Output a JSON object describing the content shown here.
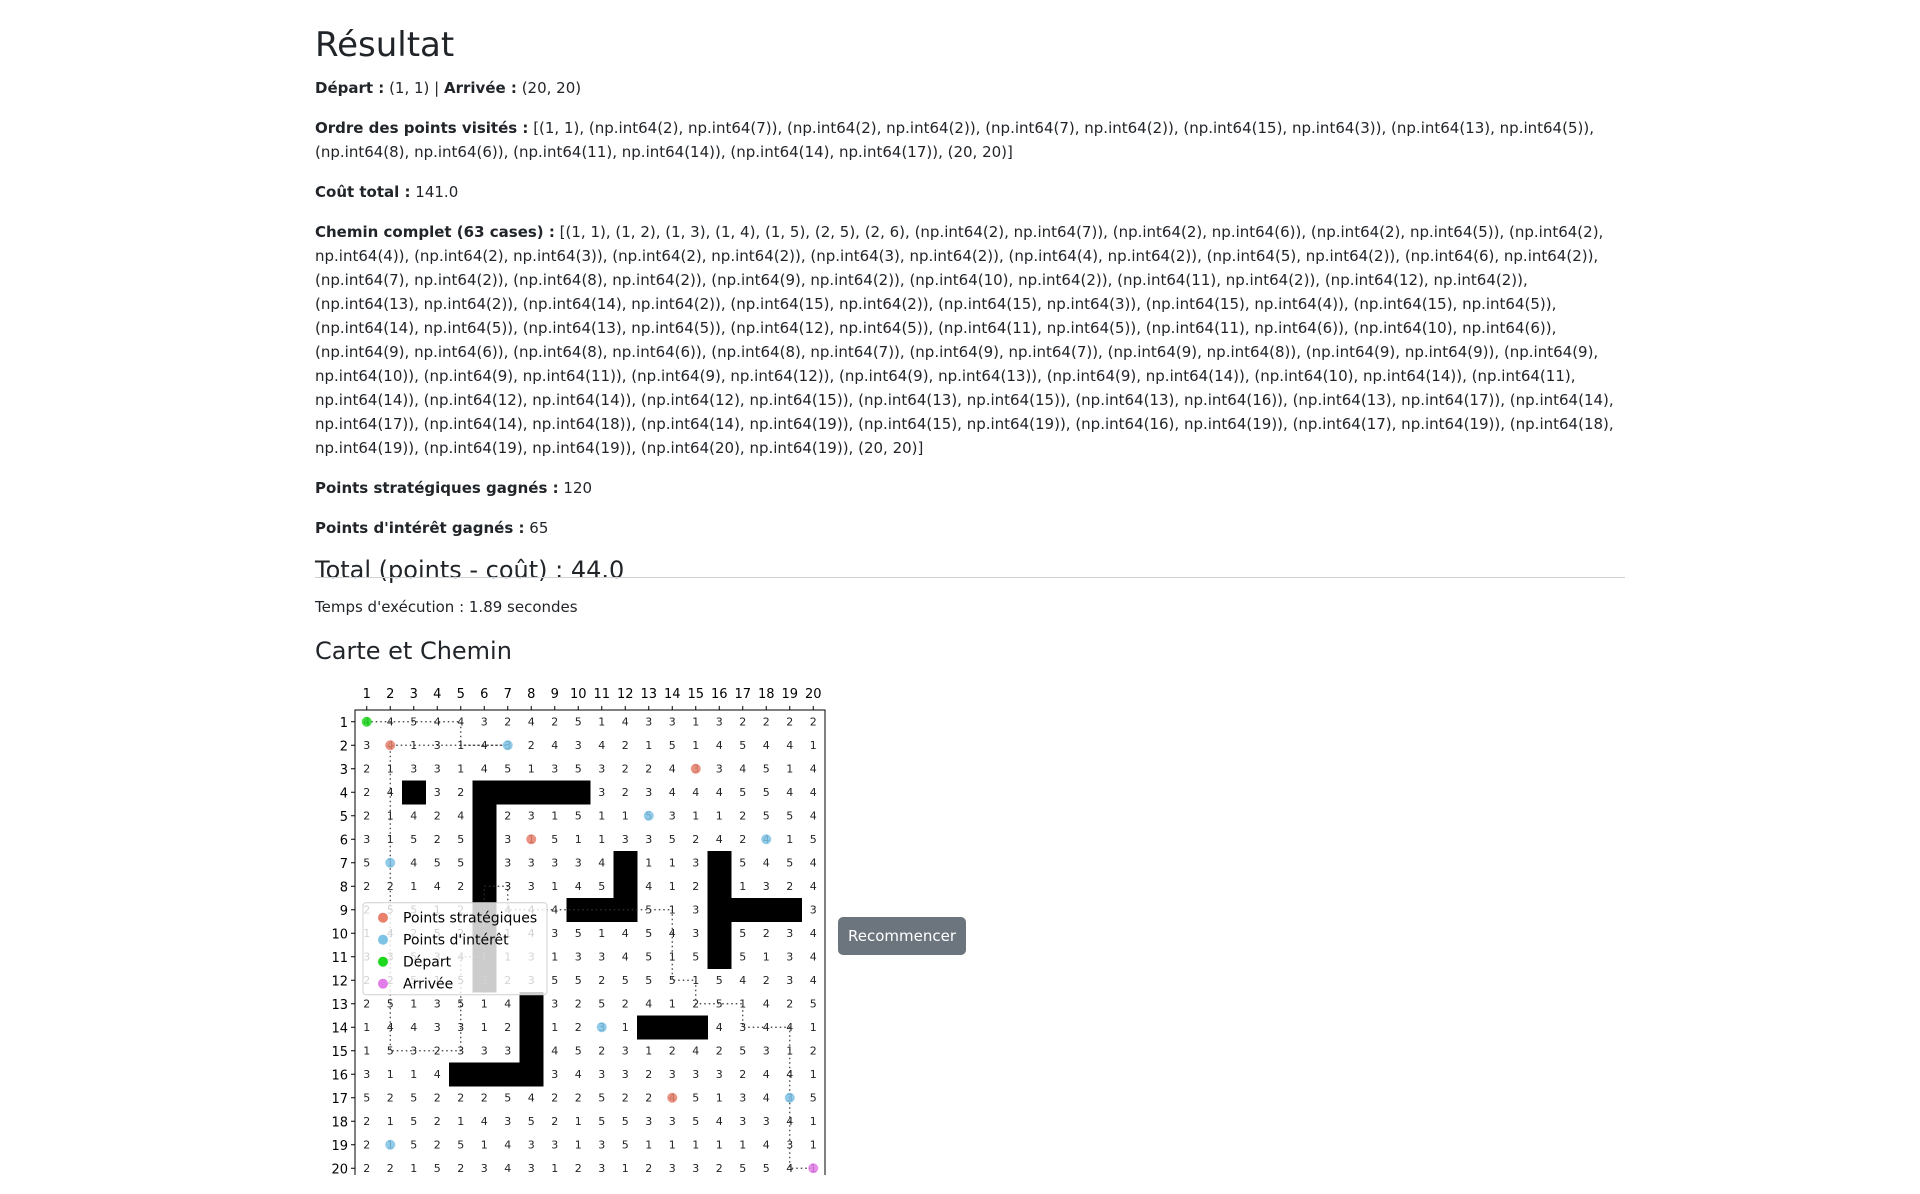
{
  "heading": "Résultat",
  "depart_label": "Départ :",
  "depart_value": "(1, 1)",
  "separator": "|",
  "arrivee_label": "Arrivée :",
  "arrivee_value": "(20, 20)",
  "ordre_label": "Ordre des points visités :",
  "ordre_value": "[(1, 1), (np.int64(2), np.int64(7)), (np.int64(2), np.int64(2)), (np.int64(7), np.int64(2)), (np.int64(15), np.int64(3)), (np.int64(13), np.int64(5)), (np.int64(8), np.int64(6)), (np.int64(11), np.int64(14)), (np.int64(14), np.int64(17)), (20, 20)]",
  "cout_label": "Coût total :",
  "cout_value": "141.0",
  "chemin_label": "Chemin complet (63 cases) :",
  "chemin_value": "[(1, 1), (1, 2), (1, 3), (1, 4), (1, 5), (2, 5), (2, 6), (np.int64(2), np.int64(7)), (np.int64(2), np.int64(6)), (np.int64(2), np.int64(5)), (np.int64(2), np.int64(4)), (np.int64(2), np.int64(3)), (np.int64(2), np.int64(2)), (np.int64(3), np.int64(2)), (np.int64(4), np.int64(2)), (np.int64(5), np.int64(2)), (np.int64(6), np.int64(2)), (np.int64(7), np.int64(2)), (np.int64(8), np.int64(2)), (np.int64(9), np.int64(2)), (np.int64(10), np.int64(2)), (np.int64(11), np.int64(2)), (np.int64(12), np.int64(2)), (np.int64(13), np.int64(2)), (np.int64(14), np.int64(2)), (np.int64(15), np.int64(2)), (np.int64(15), np.int64(3)), (np.int64(15), np.int64(4)), (np.int64(15), np.int64(5)), (np.int64(14), np.int64(5)), (np.int64(13), np.int64(5)), (np.int64(12), np.int64(5)), (np.int64(11), np.int64(5)), (np.int64(11), np.int64(6)), (np.int64(10), np.int64(6)), (np.int64(9), np.int64(6)), (np.int64(8), np.int64(6)), (np.int64(8), np.int64(7)), (np.int64(9), np.int64(7)), (np.int64(9), np.int64(8)), (np.int64(9), np.int64(9)), (np.int64(9), np.int64(10)), (np.int64(9), np.int64(11)), (np.int64(9), np.int64(12)), (np.int64(9), np.int64(13)), (np.int64(9), np.int64(14)), (np.int64(10), np.int64(14)), (np.int64(11), np.int64(14)), (np.int64(12), np.int64(14)), (np.int64(12), np.int64(15)), (np.int64(13), np.int64(15)), (np.int64(13), np.int64(16)), (np.int64(13), np.int64(17)), (np.int64(14), np.int64(17)), (np.int64(14), np.int64(18)), (np.int64(14), np.int64(19)), (np.int64(15), np.int64(19)), (np.int64(16), np.int64(19)), (np.int64(17), np.int64(19)), (np.int64(18), np.int64(19)), (np.int64(19), np.int64(19)), (np.int64(20), np.int64(19)), (20, 20)]",
  "strat_label": "Points stratégiques gagnés :",
  "strat_value": "120",
  "interet_label": "Points d'intérêt gagnés :",
  "interet_value": "65",
  "total_label": "Total (points - coût) : 44.0",
  "exec_time": "Temps d'exécution : 1.89 secondes",
  "map_title": "Carte et Chemin",
  "button_label": "Recommencer",
  "chart_data": {
    "type": "heatmap",
    "x_ticks": [
      "1",
      "2",
      "3",
      "4",
      "5",
      "6",
      "7",
      "8",
      "9",
      "10",
      "11",
      "12",
      "13",
      "14",
      "15",
      "16",
      "17",
      "18",
      "19",
      "20"
    ],
    "y_ticks": [
      "1",
      "2",
      "3",
      "4",
      "5",
      "6",
      "7",
      "8",
      "9",
      "10",
      "11",
      "12",
      "13",
      "14",
      "15",
      "16",
      "17",
      "18",
      "19",
      "20"
    ],
    "grid": [
      [
        4,
        4,
        5,
        4,
        4,
        3,
        2,
        4,
        2,
        5,
        1,
        4,
        3,
        3,
        1,
        3,
        2,
        2,
        2,
        2
      ],
      [
        3,
        4,
        1,
        3,
        1,
        4,
        3,
        2,
        4,
        3,
        4,
        2,
        1,
        5,
        1,
        4,
        5,
        4,
        4,
        1
      ],
      [
        2,
        1,
        3,
        3,
        1,
        4,
        5,
        1,
        3,
        5,
        3,
        2,
        2,
        4,
        3,
        3,
        4,
        5,
        1,
        4
      ],
      [
        2,
        4,
        0,
        3,
        2,
        0,
        0,
        0,
        0,
        0,
        3,
        2,
        3,
        4,
        4,
        4,
        5,
        5,
        4,
        4
      ],
      [
        2,
        1,
        4,
        2,
        4,
        0,
        2,
        3,
        1,
        5,
        1,
        1,
        5,
        3,
        1,
        1,
        2,
        5,
        5,
        4
      ],
      [
        3,
        1,
        5,
        2,
        5,
        0,
        3,
        1,
        5,
        1,
        1,
        3,
        3,
        5,
        2,
        4,
        2,
        4,
        1,
        5
      ],
      [
        5,
        1,
        4,
        5,
        5,
        0,
        3,
        3,
        3,
        3,
        4,
        0,
        1,
        1,
        3,
        0,
        5,
        4,
        5,
        4
      ],
      [
        2,
        2,
        1,
        4,
        2,
        0,
        3,
        3,
        1,
        4,
        5,
        0,
        4,
        1,
        2,
        0,
        1,
        3,
        2,
        4
      ],
      [
        2,
        5,
        5,
        1,
        2,
        0,
        4,
        4,
        4,
        0,
        0,
        0,
        5,
        1,
        3,
        0,
        0,
        0,
        0,
        3
      ],
      [
        1,
        4,
        2,
        5,
        2,
        0,
        1,
        4,
        3,
        5,
        1,
        4,
        5,
        4,
        3,
        0,
        5,
        2,
        3,
        4
      ],
      [
        3,
        3,
        5,
        3,
        4,
        1,
        1,
        3,
        1,
        3,
        3,
        4,
        5,
        1,
        5,
        0,
        5,
        1,
        3,
        4
      ],
      [
        2,
        2,
        5,
        1,
        5,
        3,
        2,
        3,
        5,
        5,
        2,
        5,
        5,
        5,
        1,
        5,
        4,
        2,
        3,
        4
      ],
      [
        2,
        5,
        1,
        3,
        5,
        1,
        4,
        0,
        3,
        2,
        5,
        2,
        4,
        1,
        2,
        5,
        1,
        4,
        2,
        5
      ],
      [
        1,
        4,
        4,
        3,
        3,
        1,
        2,
        0,
        1,
        2,
        3,
        1,
        0,
        0,
        0,
        4,
        3,
        4,
        4,
        1
      ],
      [
        1,
        5,
        3,
        2,
        3,
        3,
        3,
        0,
        4,
        5,
        2,
        3,
        1,
        2,
        4,
        2,
        5,
        3,
        1,
        2
      ],
      [
        3,
        1,
        1,
        4,
        0,
        0,
        0,
        0,
        3,
        4,
        3,
        3,
        2,
        3,
        3,
        3,
        2,
        4,
        4,
        1
      ],
      [
        5,
        2,
        5,
        2,
        2,
        2,
        5,
        4,
        2,
        2,
        5,
        2,
        2,
        4,
        5,
        1,
        3,
        4,
        3,
        5
      ],
      [
        2,
        1,
        5,
        2,
        1,
        4,
        3,
        5,
        2,
        1,
        5,
        5,
        3,
        3,
        5,
        4,
        3,
        3,
        4,
        1
      ],
      [
        2,
        1,
        5,
        2,
        5,
        1,
        4,
        3,
        3,
        1,
        3,
        5,
        1,
        1,
        1,
        1,
        1,
        4,
        3,
        1
      ],
      [
        2,
        2,
        1,
        5,
        2,
        3,
        4,
        3,
        1,
        2,
        3,
        1,
        2,
        3,
        3,
        2,
        5,
        5,
        4,
        1
      ]
    ],
    "obstacles": [
      [
        4,
        3
      ],
      [
        4,
        6
      ],
      [
        4,
        7
      ],
      [
        4,
        8
      ],
      [
        4,
        9
      ],
      [
        4,
        10
      ],
      [
        5,
        6
      ],
      [
        6,
        6
      ],
      [
        7,
        6
      ],
      [
        8,
        6
      ],
      [
        9,
        6
      ],
      [
        10,
        6
      ],
      [
        11,
        6
      ],
      [
        12,
        6
      ],
      [
        7,
        12
      ],
      [
        8,
        12
      ],
      [
        9,
        10
      ],
      [
        9,
        11
      ],
      [
        9,
        12
      ],
      [
        7,
        16
      ],
      [
        8,
        16
      ],
      [
        9,
        16
      ],
      [
        10,
        16
      ],
      [
        11,
        16
      ],
      [
        9,
        17
      ],
      [
        9,
        18
      ],
      [
        9,
        19
      ],
      [
        13,
        8
      ],
      [
        14,
        8
      ],
      [
        15,
        8
      ],
      [
        16,
        8
      ],
      [
        16,
        5
      ],
      [
        16,
        6
      ],
      [
        16,
        7
      ],
      [
        14,
        13
      ],
      [
        14,
        14
      ],
      [
        14,
        15
      ]
    ],
    "strategic_points": [
      [
        2,
        2
      ],
      [
        3,
        15
      ],
      [
        6,
        8
      ],
      [
        17,
        14
      ]
    ],
    "interest_points": [
      [
        2,
        7
      ],
      [
        7,
        2
      ],
      [
        5,
        13
      ],
      [
        6,
        18
      ],
      [
        14,
        11
      ],
      [
        17,
        19
      ],
      [
        19,
        2
      ]
    ],
    "depart": [
      1,
      1
    ],
    "arrivee": [
      20,
      20
    ],
    "path": [
      [
        1,
        1
      ],
      [
        2,
        1
      ],
      [
        3,
        1
      ],
      [
        4,
        1
      ],
      [
        5,
        1
      ],
      [
        5,
        2
      ],
      [
        6,
        2
      ],
      [
        7,
        2
      ],
      [
        6,
        2
      ],
      [
        5,
        2
      ],
      [
        4,
        2
      ],
      [
        3,
        2
      ],
      [
        2,
        2
      ],
      [
        2,
        3
      ],
      [
        2,
        4
      ],
      [
        2,
        5
      ],
      [
        2,
        6
      ],
      [
        2,
        7
      ],
      [
        2,
        8
      ],
      [
        2,
        9
      ],
      [
        2,
        10
      ],
      [
        2,
        11
      ],
      [
        2,
        12
      ],
      [
        2,
        13
      ],
      [
        2,
        14
      ],
      [
        2,
        15
      ],
      [
        3,
        15
      ],
      [
        4,
        15
      ],
      [
        5,
        15
      ],
      [
        5,
        14
      ],
      [
        5,
        13
      ],
      [
        5,
        12
      ],
      [
        5,
        11
      ],
      [
        6,
        11
      ],
      [
        6,
        10
      ],
      [
        6,
        9
      ],
      [
        6,
        8
      ],
      [
        7,
        8
      ],
      [
        7,
        9
      ],
      [
        8,
        9
      ],
      [
        9,
        9
      ],
      [
        10,
        9
      ],
      [
        11,
        9
      ],
      [
        12,
        9
      ],
      [
        13,
        9
      ],
      [
        14,
        9
      ],
      [
        14,
        10
      ],
      [
        14,
        11
      ],
      [
        14,
        12
      ],
      [
        15,
        12
      ],
      [
        15,
        13
      ],
      [
        16,
        13
      ],
      [
        17,
        13
      ],
      [
        17,
        14
      ],
      [
        18,
        14
      ],
      [
        19,
        14
      ],
      [
        19,
        15
      ],
      [
        19,
        16
      ],
      [
        19,
        17
      ],
      [
        19,
        18
      ],
      [
        19,
        19
      ],
      [
        19,
        20
      ],
      [
        20,
        20
      ]
    ],
    "legend": [
      "Points stratégiques",
      "Points d'intérêt",
      "Départ",
      "Arrivée"
    ],
    "legend_placement": "center-left",
    "colors": {
      "strategic": "#e8806c",
      "interest": "#7cc3e6",
      "depart": "#1ed81e",
      "arrivee": "#e27de8",
      "obstacle": "#000000",
      "path": "#333333"
    }
  }
}
